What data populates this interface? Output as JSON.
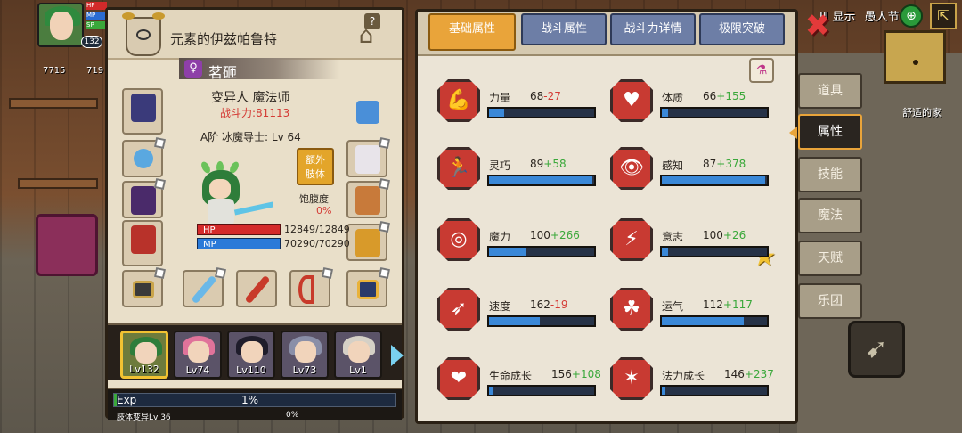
{
  "hud": {
    "level": "132",
    "bar_hp": "HP",
    "bar_mp": "MP",
    "bar_sp": "SP",
    "coins_left": "7715",
    "coins_right": "719"
  },
  "top_right": {
    "text_a": "ⅠⅡ 显示",
    "text_b": "愚人节",
    "place": "舒适的家"
  },
  "character": {
    "title": "元素的伊兹帕鲁特",
    "name": "茗砸",
    "class_line": "变异人 魔法师",
    "power": "战斗力:81113",
    "rank_line": "A阶 冰魔导士: Lv 64",
    "extra_button": "额外\n肢体",
    "hunger_label": "饱腹度",
    "hunger_value": "0%",
    "hp_label": "HP",
    "mp_label": "MP",
    "hp_value": "12849/12849",
    "mp_value": "70290/70290",
    "hp_fraction": 1.0,
    "mp_fraction": 1.0
  },
  "party": [
    {
      "level": "Lv132",
      "hair": "#2e7d3a",
      "active": true
    },
    {
      "level": "Lv74",
      "hair": "#e0739a",
      "active": false
    },
    {
      "level": "Lv110",
      "hair": "#1f1d2b",
      "active": false
    },
    {
      "level": "Lv73",
      "hair": "#8a8fa8",
      "active": false
    },
    {
      "level": "Lv1",
      "hair": "#d5d0c6",
      "active": false
    }
  ],
  "exp": {
    "label": "Exp",
    "percent": "1%",
    "fraction": 0.01,
    "transform_label": "肢体变异Lv 36",
    "transform_percent": "0%"
  },
  "tabs": [
    "基础属性",
    "战斗属性",
    "战斗力详情",
    "极限突破"
  ],
  "active_tab": 0,
  "stats": [
    {
      "label": "力量",
      "base": "68",
      "bonus": "-27",
      "sign": "neg",
      "fill": 0.14,
      "icon": "muscle-icon",
      "glyph": "💪"
    },
    {
      "label": "体质",
      "base": "66",
      "bonus": "+155",
      "sign": "pos",
      "fill": 0.06,
      "icon": "torso-icon",
      "glyph": "♥"
    },
    {
      "label": "灵巧",
      "base": "89",
      "bonus": "+58",
      "sign": "pos",
      "fill": 0.98,
      "icon": "runner-icon",
      "glyph": "🏃"
    },
    {
      "label": "感知",
      "base": "87",
      "bonus": "+378",
      "sign": "pos",
      "fill": 0.98,
      "icon": "eye-icon",
      "glyph": "👁"
    },
    {
      "label": "魔力",
      "base": "100",
      "bonus": "+266",
      "sign": "pos",
      "fill": 0.36,
      "icon": "swirl-icon",
      "glyph": "◎"
    },
    {
      "label": "意志",
      "base": "100",
      "bonus": "+26",
      "sign": "pos",
      "fill": 0.06,
      "icon": "head-bolt-icon",
      "glyph": "⚡"
    },
    {
      "label": "速度",
      "base": "162",
      "bonus": "-19",
      "sign": "neg",
      "fill": 0.48,
      "icon": "speed-icon",
      "glyph": "➶"
    },
    {
      "label": "运气",
      "base": "112",
      "bonus": "+117",
      "sign": "pos",
      "fill": 0.78,
      "icon": "clover-icon",
      "glyph": "☘"
    },
    {
      "label": "生命成长",
      "base": "156",
      "bonus": "+108",
      "sign": "pos",
      "fill": 0.03,
      "icon": "heart-growth-icon",
      "glyph": "❤"
    },
    {
      "label": "法力成长",
      "base": "146",
      "bonus": "+237",
      "sign": "pos",
      "fill": 0.03,
      "icon": "mana-growth-icon",
      "glyph": "✶"
    }
  ],
  "side_tabs": [
    "道具",
    "属性",
    "技能",
    "魔法",
    "天赋",
    "乐团"
  ],
  "active_side_tab": 1,
  "colors": {
    "stat_icon": "#c83a32",
    "active_tab": "#e9a43a",
    "tab": "#6d7ea6",
    "bar_fill": "#3a88d8",
    "bonus_pos": "#3aa83a",
    "bonus_neg": "#d43a34"
  }
}
